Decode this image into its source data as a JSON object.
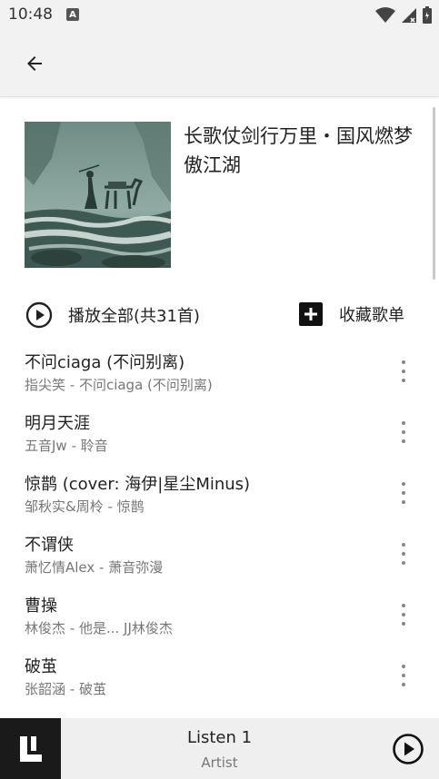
{
  "status_bar": {
    "time": "10:48",
    "notification_letter": "A",
    "icons": [
      "wifi-icon",
      "signal-icon",
      "battery-icon"
    ]
  },
  "app_bar": {
    "back_icon": "arrow-left-icon"
  },
  "playlist": {
    "title": "长歌仗剑行万里・国风燃梦傲江湖",
    "cover_alt": "ink-painting-cover"
  },
  "actions": {
    "play_all_label": "播放全部(共31首)",
    "play_all_icon": "play-circle-icon",
    "collect_label": "收藏歌单",
    "collect_icon": "add-box-icon"
  },
  "songs": [
    {
      "title": "不问ciaga (不问别离)",
      "subtitle": "指尖笑 - 不问ciaga (不问别离)"
    },
    {
      "title": "明月天涯",
      "subtitle": "五音Jw - 聆音"
    },
    {
      "title": "惊鹊 (cover: 海伊|星尘Minus)",
      "subtitle": "邹秋实&周柃 - 惊鹊"
    },
    {
      "title": "不谓侠",
      "subtitle": "萧忆情Alex - 萧音弥漫"
    },
    {
      "title": "曹操",
      "subtitle": "林俊杰 - 他是... JJ林俊杰"
    },
    {
      "title": "破茧",
      "subtitle": "张韶涵 - 破茧"
    }
  ],
  "player": {
    "title": "Listen 1",
    "artist": "Artist",
    "logo_icon": "listen1-logo-icon",
    "play_icon": "play-circle-icon"
  },
  "colors": {
    "bar_background": "#f2f2f2",
    "player_background": "#efefef",
    "logo_background": "#1a1a1a",
    "primary_text": "#222222",
    "secondary_text": "#777777"
  }
}
